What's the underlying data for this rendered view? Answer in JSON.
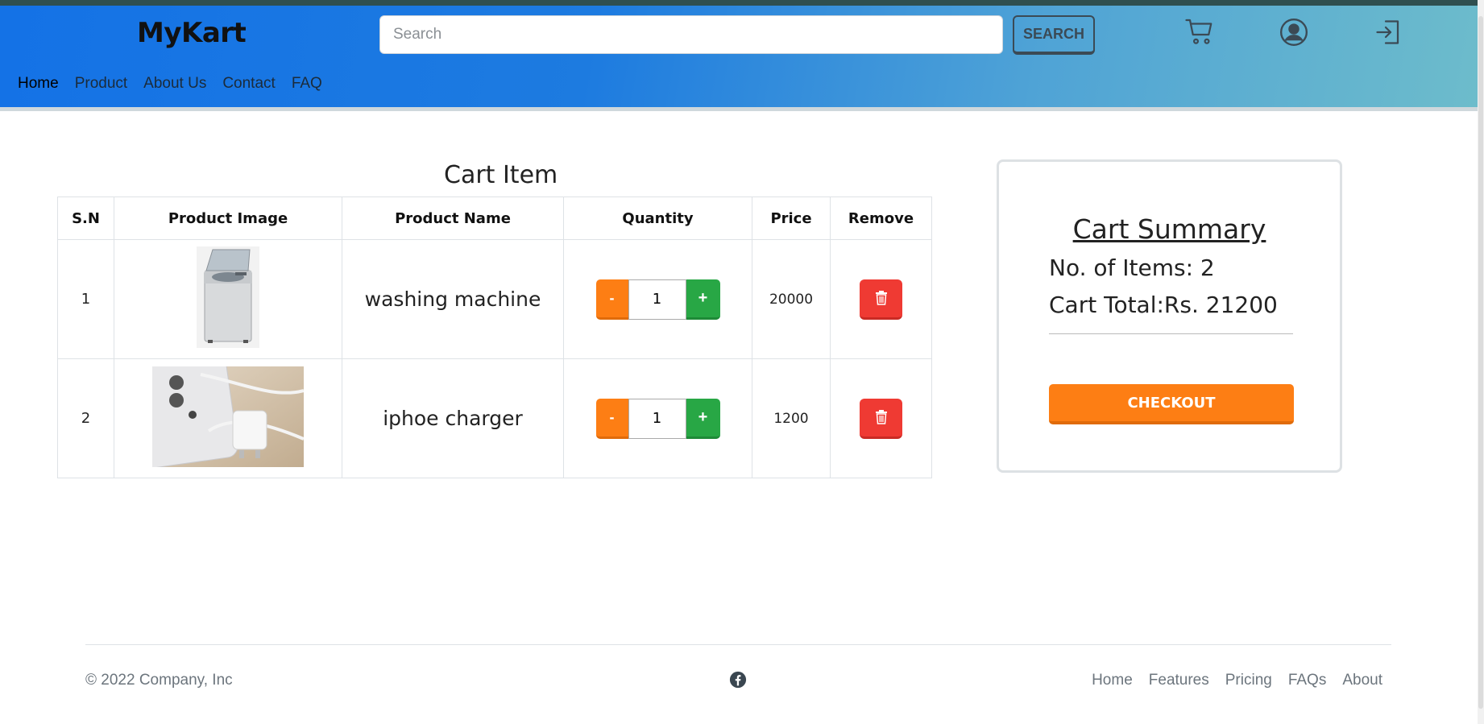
{
  "header": {
    "brand": "MyKart",
    "search_placeholder": "Search",
    "search_button": "SEARCH",
    "nav": [
      "Home",
      "Product",
      "About Us",
      "Contact",
      "FAQ"
    ]
  },
  "cart": {
    "title": "Cart Item",
    "columns": [
      "S.N",
      "Product Image",
      "Product Name",
      "Quantity",
      "Price",
      "Remove"
    ],
    "rows": [
      {
        "sn": "1",
        "name": "washing machine",
        "quantity": "1",
        "price": "20000",
        "minus": "-",
        "plus": "+"
      },
      {
        "sn": "2",
        "name": "iphoe charger",
        "quantity": "1",
        "price": "1200",
        "minus": "-",
        "plus": "+"
      }
    ]
  },
  "summary": {
    "title": "Cart Summary",
    "items_label": "No. of Items: 2",
    "total_label": "Cart Total:Rs. 21200",
    "checkout": "CHECKOUT"
  },
  "footer": {
    "copyright": "© 2022 Company, Inc",
    "links": [
      "Home",
      "Features",
      "Pricing",
      "FAQs",
      "About"
    ]
  },
  "icons": {
    "cart": "cart-icon",
    "user": "user-circle-icon",
    "login": "sign-in-icon",
    "trash": "trash-icon",
    "facebook": "facebook-icon"
  },
  "colors": {
    "orange": "#fd7e14",
    "green": "#28a745",
    "red": "#ef3a33",
    "header_blue": "#1472e6",
    "header_teal": "#6dbccb"
  }
}
